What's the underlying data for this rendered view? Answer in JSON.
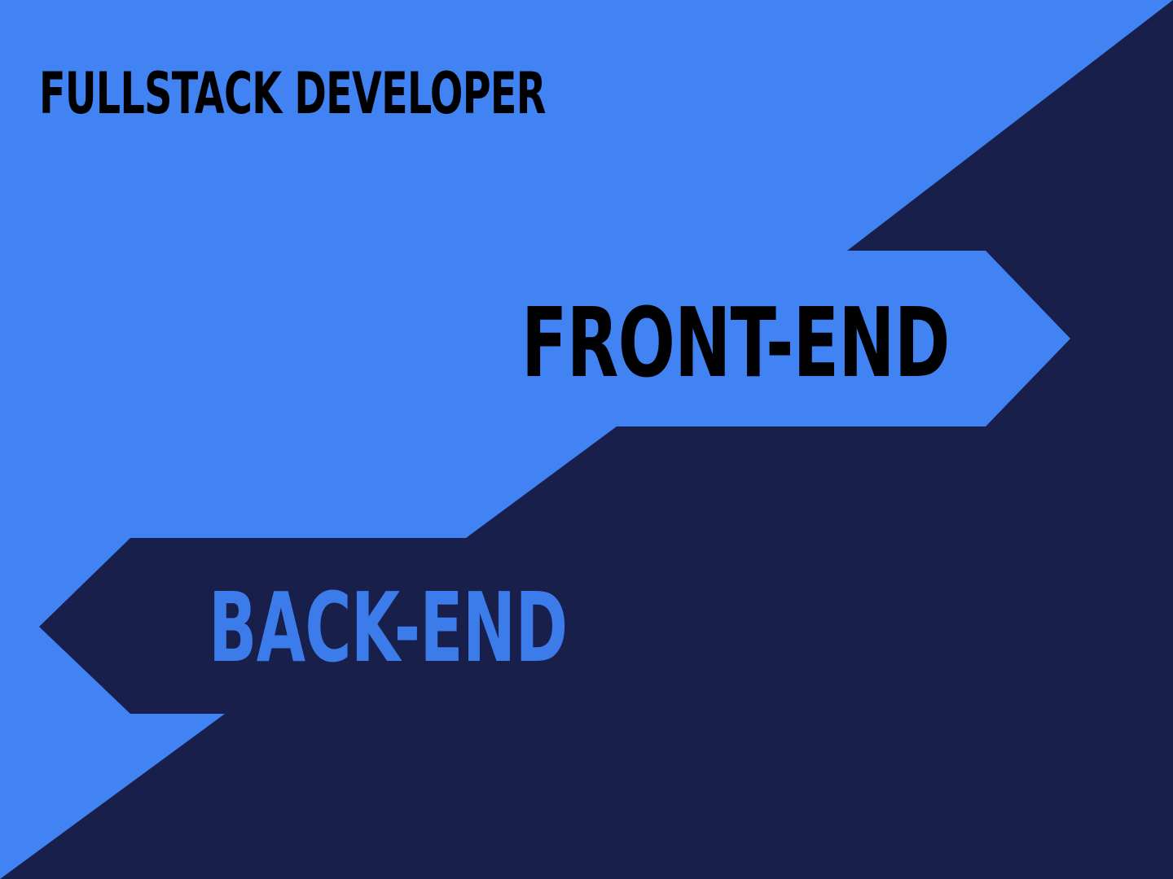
{
  "title": "FULLSTACK DEVELOPER",
  "front_label": "FRONT-END",
  "back_label": "BACK-END",
  "colors": {
    "light_blue": "#4283F3",
    "navy": "#181F4B",
    "title_text": "#000000",
    "front_text": "#000000",
    "back_text": "#3C7BEA"
  }
}
